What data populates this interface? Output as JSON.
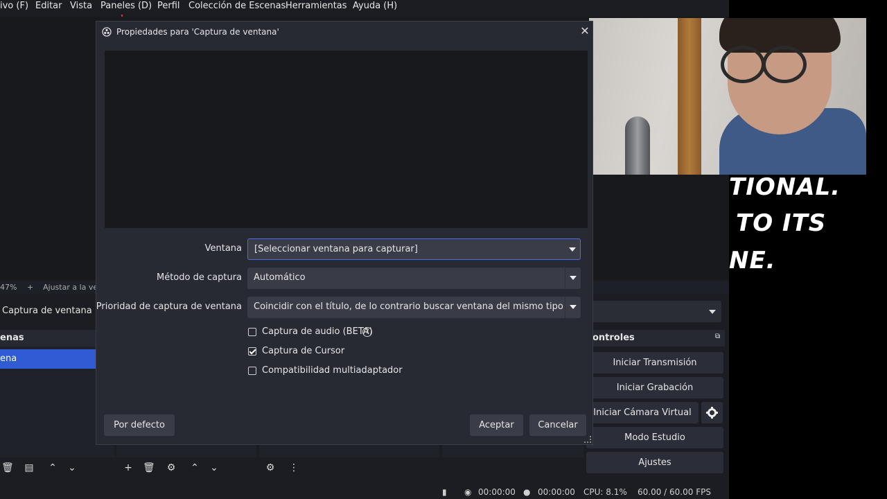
{
  "menu": {
    "items": [
      "ivo (F)",
      "Editar",
      "Vista",
      "Paneles (D)",
      "Perfil",
      "Colección de Escenas",
      "Herramientas",
      "Ayuda (H)"
    ]
  },
  "preview_strip": {
    "zoom": "47%",
    "plus": "+",
    "fit_label": "Ajustar a la ven"
  },
  "sources_bar": {
    "selected_source": "Captura de ventana"
  },
  "panels": {
    "scenes_title": "enas",
    "scene_selected": "ena",
    "controls_title": "ontroles"
  },
  "controls": {
    "start_stream": "Iniciar Transmisión",
    "start_recording": "Iniciar Grabación",
    "start_virtual_cam": "Iniciar Cámara Virtual",
    "studio_mode": "Modo Estudio",
    "settings": "Ajustes"
  },
  "status": {
    "stream_time": "00:00:00",
    "rec_time": "00:00:00",
    "cpu": "CPU: 8.1%",
    "fps": "60.00 / 60.00 FPS"
  },
  "overlay": {
    "line1": "TIONAL.",
    "line2": "TO ITS",
    "line3": "NE."
  },
  "dialog": {
    "title": "Propiedades para 'Captura de ventana'",
    "window_label": "Ventana",
    "window_value": "[Seleccionar ventana para capturar]",
    "method_label": "Método de captura",
    "method_value": "Automático",
    "priority_label": "Prioridad de captura de ventana",
    "priority_value": "Coincidir con el título, de lo contrario buscar ventana del mismo tipo",
    "audio_capture_label": "Captura de audio (BETA)",
    "audio_capture_checked": false,
    "cursor_capture_label": "Captura de Cursor",
    "cursor_capture_checked": true,
    "multiadapter_label": "Compatibilidad multiadaptador",
    "multiadapter_checked": false,
    "defaults_button": "Por defecto",
    "ok_button": "Aceptar",
    "cancel_button": "Cancelar"
  },
  "colors": {
    "accent": "#2f5bd3",
    "focus_border": "#4a6ee0",
    "background": "#1b1d23",
    "dialog_bg": "#272a33"
  }
}
